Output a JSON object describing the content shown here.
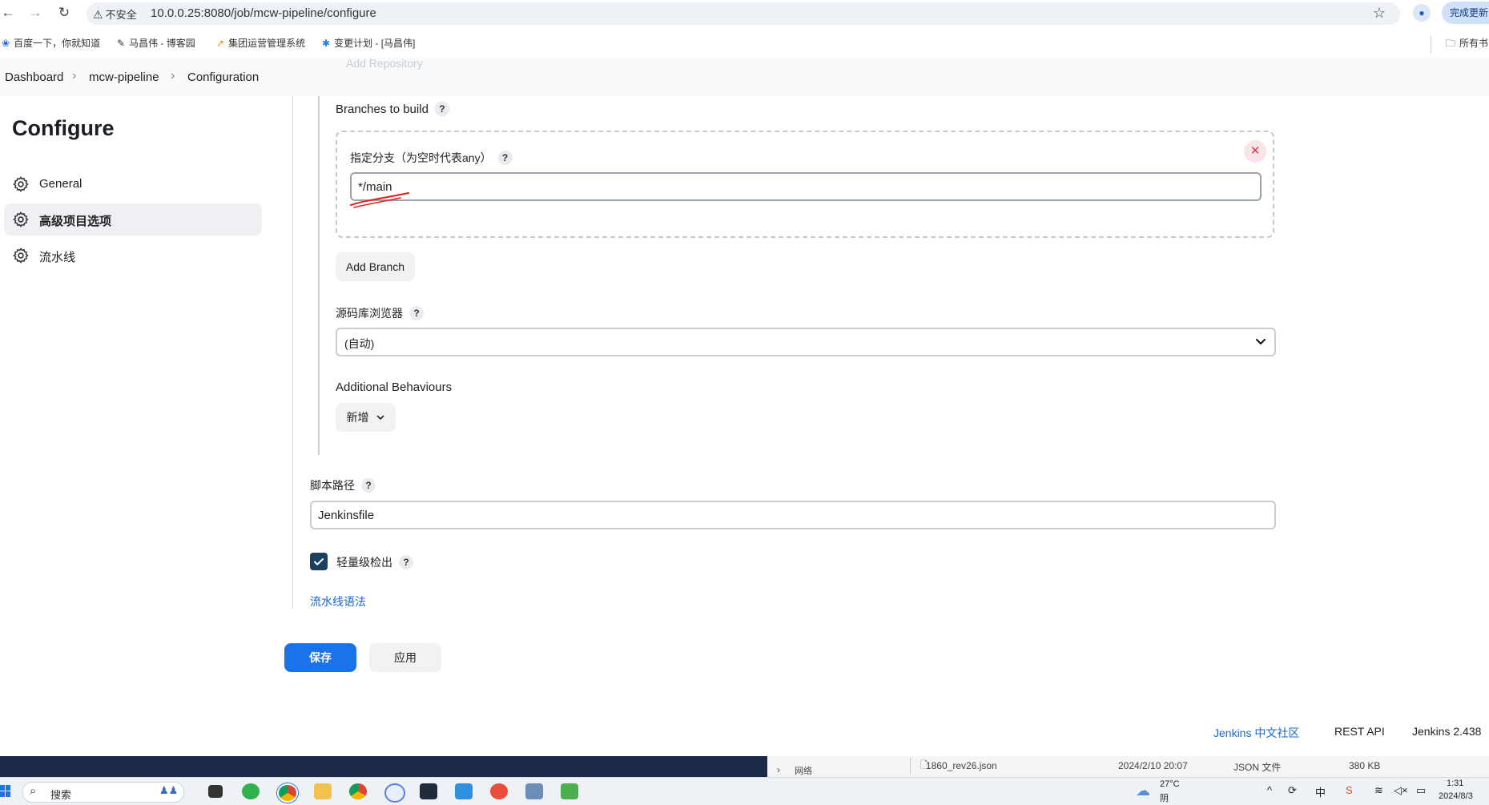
{
  "browser": {
    "security_label": "不安全",
    "url": "10.0.0.25:8080/job/mcw-pipeline/configure",
    "update_label": "完成更新",
    "bookmarks": [
      {
        "label": "百度一下，你就知道",
        "icon": "paw-icon"
      },
      {
        "label": "马昌伟 - 博客园",
        "icon": "pen-icon"
      },
      {
        "label": "集团运营管理系统",
        "icon": "chart-icon"
      },
      {
        "label": "变更计划 - [马昌伟]",
        "icon": "butterfly-icon"
      }
    ],
    "bookmark_folder": "所有书"
  },
  "breadcrumb": {
    "items": [
      "Dashboard",
      "mcw-pipeline",
      "Configuration"
    ],
    "ghost_text": "Add Repository"
  },
  "sidebar": {
    "title": "Configure",
    "items": [
      {
        "label": "General",
        "active": false
      },
      {
        "label": "高级项目选项",
        "active": true
      },
      {
        "label": "流水线",
        "active": false
      }
    ]
  },
  "form": {
    "branches_label": "Branches to build",
    "branch_spec_label": "指定分支（为空时代表any）",
    "branch_spec_value": "*/main",
    "add_branch_label": "Add Branch",
    "repo_browser_label": "源码库浏览器",
    "repo_browser_value": "(自动)",
    "additional_behaviours_label": "Additional Behaviours",
    "add_label": "新增",
    "script_path_label": "脚本路径",
    "script_path_value": "Jenkinsfile",
    "lightweight_label": "轻量级检出",
    "lightweight_checked": true,
    "pipeline_syntax_link": "流水线语法",
    "save_label": "保存",
    "apply_label": "应用"
  },
  "footer": {
    "community": "Jenkins 中文社区",
    "rest_api": "REST API",
    "version": "Jenkins 2.438"
  },
  "taskbar": {
    "preview": {
      "tree_item": "网络",
      "file_name": "1860_rev26.json",
      "file_date": "2024/2/10 20:07",
      "file_type": "JSON 文件",
      "file_size": "380 KB"
    },
    "search_label": "搜索",
    "weather_temp": "27°C",
    "weather_desc": "阴",
    "time": "1:31",
    "date": "2024/8/3"
  },
  "colors": {
    "primary": "#1a73e8",
    "link": "#1967d2",
    "checkbox": "#1d3f5f",
    "annotation": "#e0201d"
  }
}
